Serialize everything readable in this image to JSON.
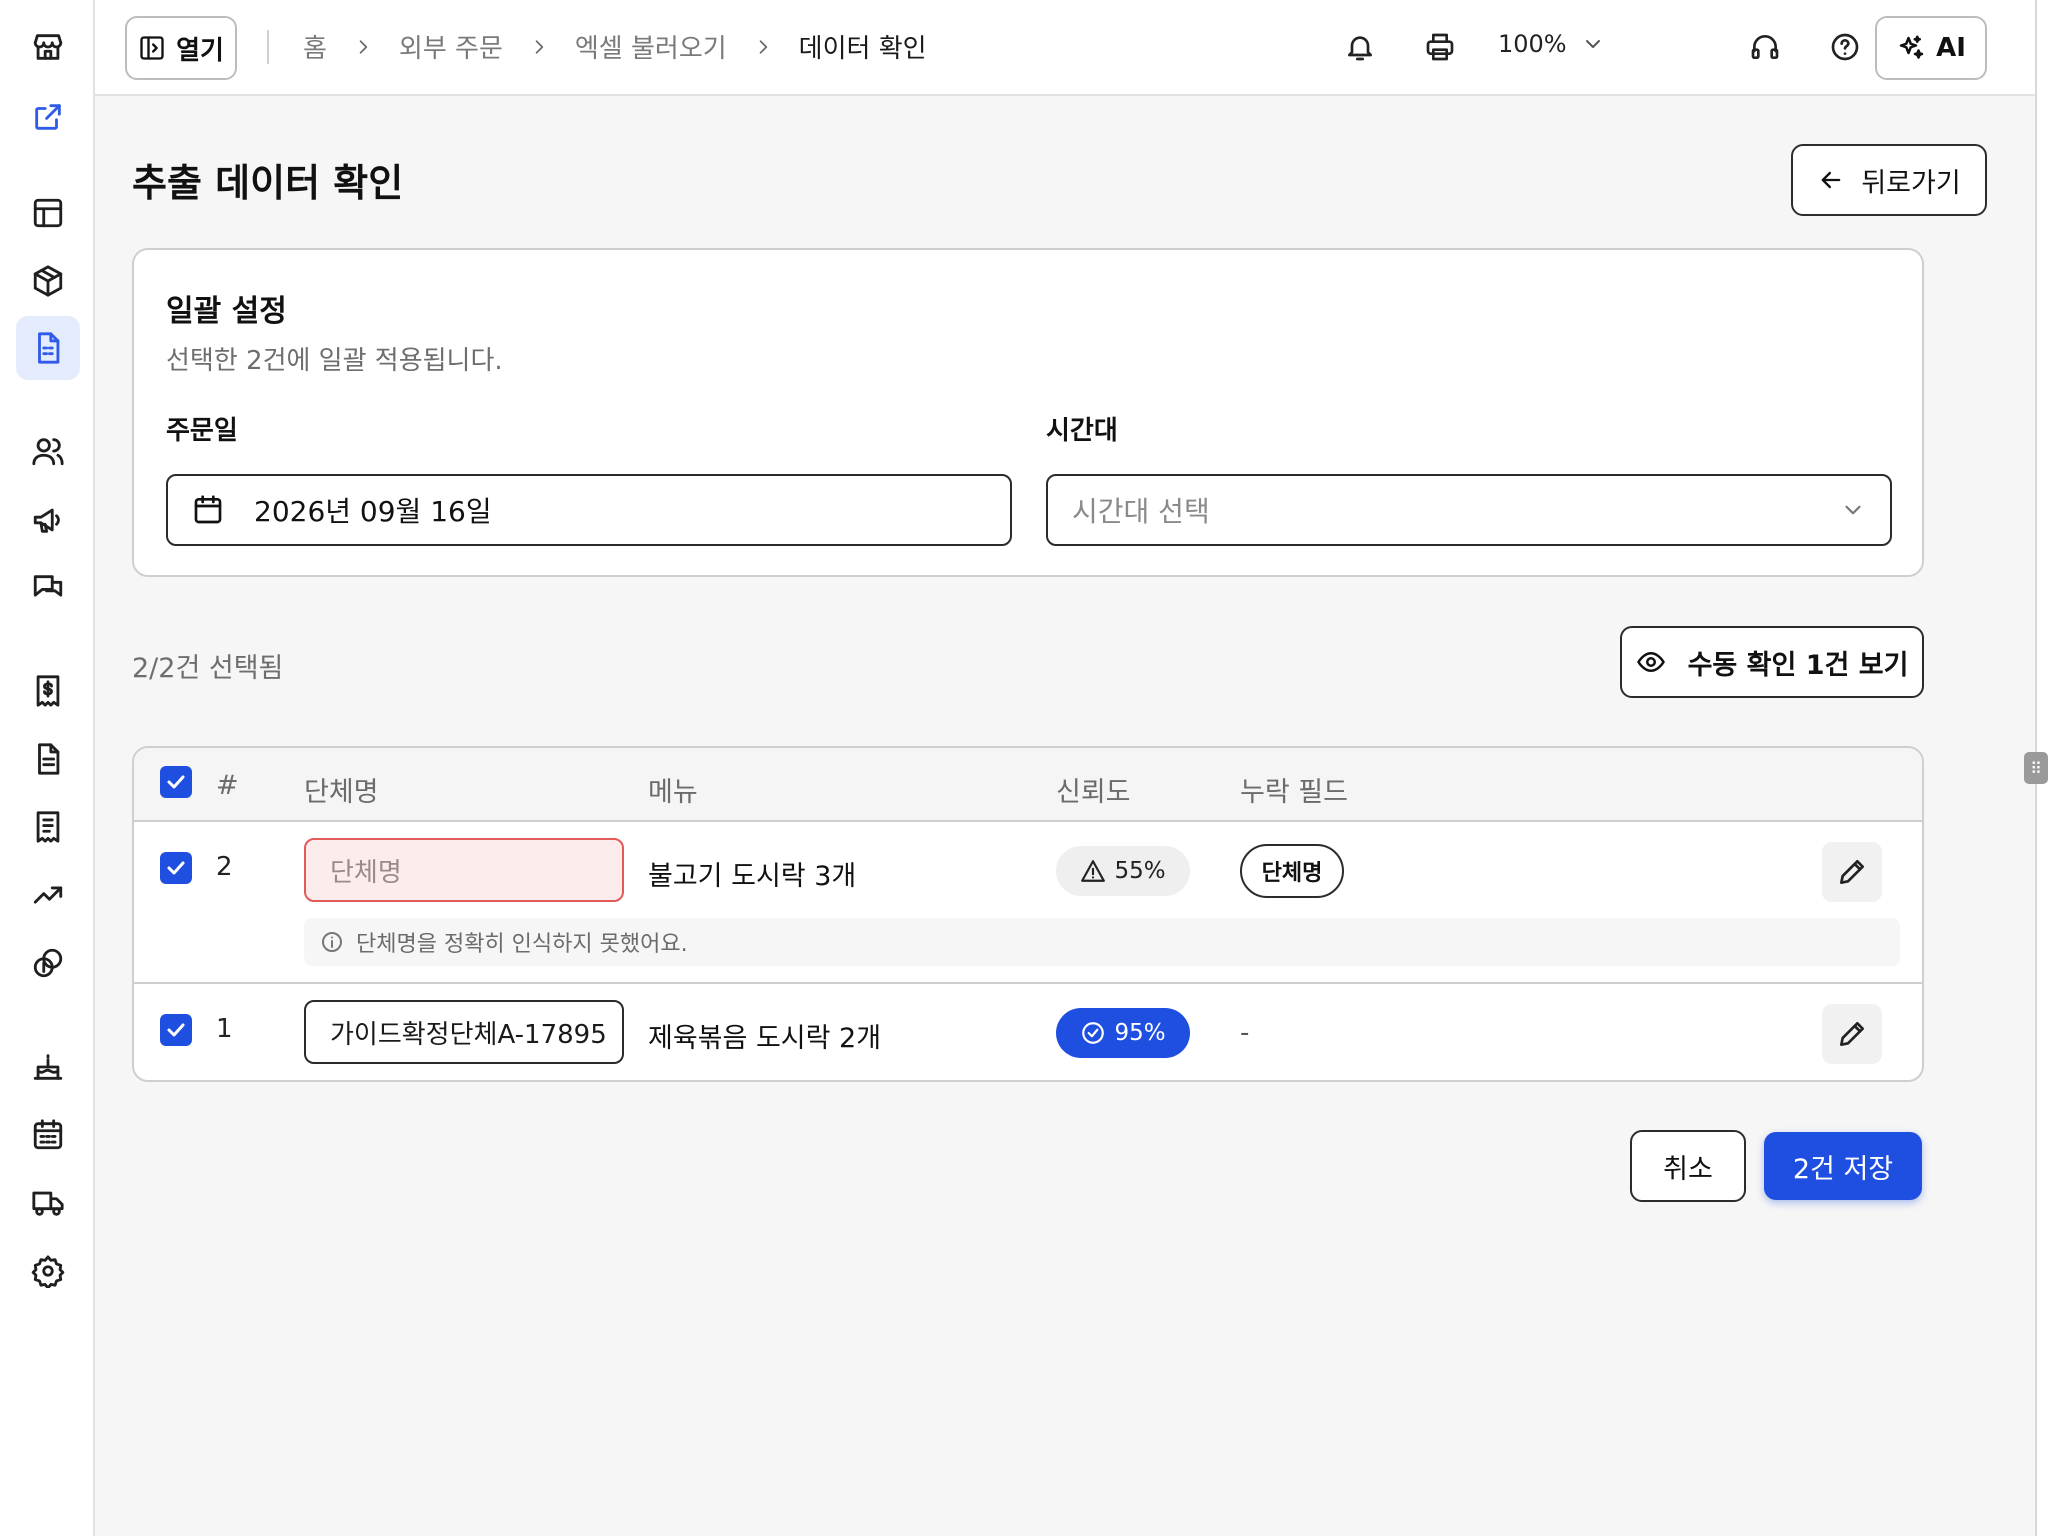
{
  "topbar": {
    "open_label": "열기",
    "breadcrumbs": [
      "홈",
      "외부 주문",
      "엑셀 불러오기",
      "데이터 확인"
    ],
    "zoom": "100%",
    "ai_label": "AI"
  },
  "page": {
    "title": "추출 데이터 확인",
    "back_label": "뒤로가기"
  },
  "bulk": {
    "title": "일괄 설정",
    "desc": "선택한 2건에 일괄 적용됩니다.",
    "date_label": "주문일",
    "date_value": "2026년 09월 16일",
    "time_label": "시간대",
    "time_placeholder": "시간대 선택"
  },
  "selection": {
    "count_text": "2/2건 선택됨",
    "manual_btn": "수동 확인 1건 보기"
  },
  "table": {
    "headers": [
      "#",
      "단체명",
      "메뉴",
      "신뢰도",
      "누락 필드"
    ],
    "rows": [
      {
        "num": "2",
        "name_placeholder": "단체명",
        "menu": "불고기 도시락 3개",
        "confidence": "55%",
        "missing": "단체명",
        "hint": "단체명을 정확히 인식하지 못했어요."
      },
      {
        "num": "1",
        "name_value": "가이드확정단체A-17895",
        "menu": "제육볶음 도시락 2개",
        "confidence": "95%",
        "missing": "-"
      }
    ]
  },
  "actions": {
    "cancel": "취소",
    "save": "2건 저장"
  },
  "colors": {
    "accent": "#1f4fe0",
    "error": "#e25a5a"
  }
}
